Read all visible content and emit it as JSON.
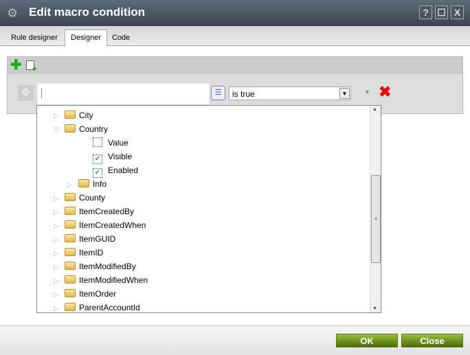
{
  "window": {
    "title": "Edit macro condition",
    "help": "?",
    "maximize": "☐",
    "close": "X"
  },
  "tabs": [
    {
      "label": "Rule designer"
    },
    {
      "label": "Designer",
      "active": true
    },
    {
      "label": "Code"
    }
  ],
  "condition": {
    "input_value": "",
    "operator": "is true"
  },
  "tree": [
    {
      "label": "City",
      "type": "folder",
      "expanded": false,
      "level": 0
    },
    {
      "label": "Country",
      "type": "folder",
      "expanded": true,
      "level": 0
    },
    {
      "label": "Value",
      "type": "checkbox",
      "checked": false,
      "level": 1
    },
    {
      "label": "Visible",
      "type": "checkbox",
      "checked": true,
      "level": 1
    },
    {
      "label": "Enabled",
      "type": "checkbox",
      "checked": true,
      "level": 1
    },
    {
      "label": "Info",
      "type": "folder",
      "expanded": false,
      "level": 1
    },
    {
      "label": "County",
      "type": "folder",
      "expanded": false,
      "level": 0
    },
    {
      "label": "ItemCreatedBy",
      "type": "folder",
      "expanded": false,
      "level": 0
    },
    {
      "label": "ItemCreatedWhen",
      "type": "folder",
      "expanded": false,
      "level": 0
    },
    {
      "label": "ItemGUID",
      "type": "folder",
      "expanded": false,
      "level": 0
    },
    {
      "label": "ItemID",
      "type": "folder",
      "expanded": false,
      "level": 0
    },
    {
      "label": "ItemModifiedBy",
      "type": "folder",
      "expanded": false,
      "level": 0
    },
    {
      "label": "ItemModifiedWhen",
      "type": "folder",
      "expanded": false,
      "level": 0
    },
    {
      "label": "ItemOrder",
      "type": "folder",
      "expanded": false,
      "level": 0
    },
    {
      "label": "ParentAccountId",
      "type": "folder",
      "expanded": false,
      "level": 0
    }
  ],
  "footer": {
    "ok": "OK",
    "close": "Close"
  }
}
